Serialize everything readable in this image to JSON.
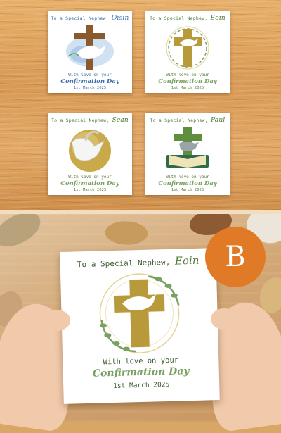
{
  "cards": [
    {
      "to": "To a Special Nephew,",
      "name": "Oisin",
      "love": "With love on your",
      "conf": "Confirmation Day",
      "date": "1st March 2025"
    },
    {
      "to": "To a Special Nephew,",
      "name": "Eoin",
      "love": "With love on your",
      "conf": "Confirmation Day",
      "date": "1st March 2025"
    },
    {
      "to": "To a Special Nephew,",
      "name": "Sean",
      "love": "With love on your",
      "conf": "Confirmation Day",
      "date": "1st March 2025"
    },
    {
      "to": "To a Special Nephew,",
      "name": "Paul",
      "love": "With love on your",
      "conf": "Confirmation Day",
      "date": "1st March 2025"
    }
  ],
  "featured": {
    "to": "To a Special Nephew,",
    "name": "Eoin",
    "love": "With love on your",
    "conf": "Confirmation Day",
    "date": "1st March 2025"
  },
  "badge": "B",
  "colors": {
    "gold": "#b99a3a",
    "green": "#7aa063",
    "blue": "#3f6fa8",
    "badge": "#e07a26"
  }
}
